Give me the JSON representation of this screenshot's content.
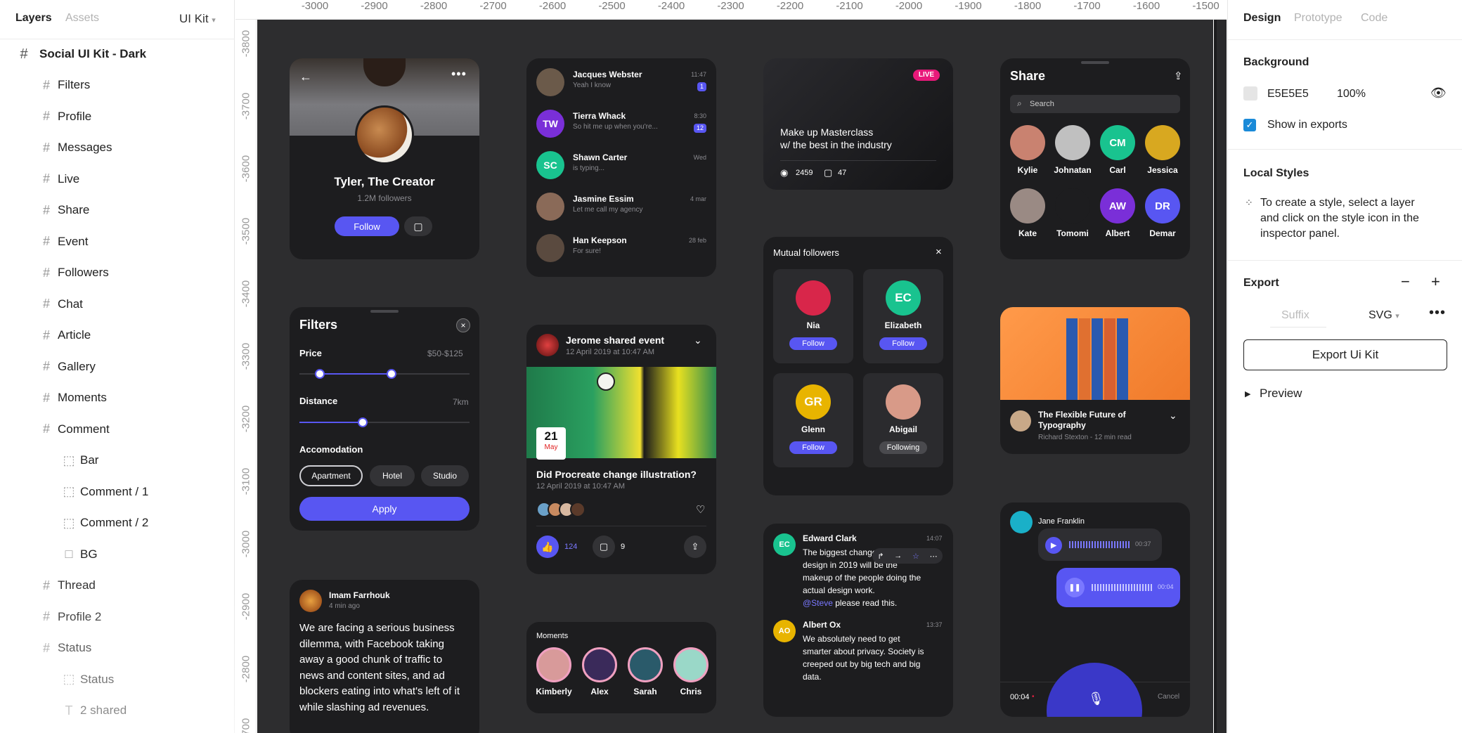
{
  "left_panel": {
    "tabs": [
      "Layers",
      "Assets"
    ],
    "page_selector": "UI Kit",
    "root": "Social UI Kit - Dark",
    "layers": [
      {
        "name": "Filters",
        "type": "frame"
      },
      {
        "name": "Profile",
        "type": "frame"
      },
      {
        "name": "Messages",
        "type": "frame"
      },
      {
        "name": "Live",
        "type": "frame"
      },
      {
        "name": "Share",
        "type": "frame"
      },
      {
        "name": "Event",
        "type": "frame"
      },
      {
        "name": "Followers",
        "type": "frame"
      },
      {
        "name": "Chat",
        "type": "frame"
      },
      {
        "name": "Article",
        "type": "frame"
      },
      {
        "name": "Gallery",
        "type": "frame"
      },
      {
        "name": "Moments",
        "type": "frame"
      },
      {
        "name": "Comment",
        "type": "frame"
      },
      {
        "name": "Bar",
        "type": "component"
      },
      {
        "name": "Comment / 1",
        "type": "component"
      },
      {
        "name": "Comment / 2",
        "type": "component"
      },
      {
        "name": "BG",
        "type": "rect"
      },
      {
        "name": "Thread",
        "type": "frame"
      },
      {
        "name": "Profile 2",
        "type": "frame"
      },
      {
        "name": "Status",
        "type": "frame"
      },
      {
        "name": "Status",
        "type": "component"
      },
      {
        "name": "2 shared",
        "type": "text"
      }
    ]
  },
  "ruler": {
    "top": [
      "-3000",
      "-2900",
      "-2800",
      "-2700",
      "-2600",
      "-2500",
      "-2400",
      "-2300",
      "-2200",
      "-2100",
      "-2000",
      "-1900",
      "-1800",
      "-1700",
      "-1600",
      "-1500"
    ],
    "left": [
      "-3800",
      "-3700",
      "-3600",
      "-3500",
      "-3400",
      "-3300",
      "-3200",
      "-3100",
      "-3000",
      "-2900",
      "-2800",
      "-2700"
    ]
  },
  "profile": {
    "name": "Tyler, The Creator",
    "followers": "1.2M followers",
    "follow": "Follow"
  },
  "messages": [
    {
      "name": "Jacques Webster",
      "text": "Yeah I know",
      "time": "11:47",
      "badge": "1",
      "initials": "",
      "color": "#6b5a4a"
    },
    {
      "name": "Tierra Whack",
      "text": "So hit me up when you're...",
      "time": "8:30",
      "badge": "12",
      "initials": "TW",
      "color": "#7a2fd8"
    },
    {
      "name": "Shawn Carter",
      "text": "is typing...",
      "time": "Wed",
      "badge": "",
      "initials": "SC",
      "color": "#19c38f"
    },
    {
      "name": "Jasmine Essim",
      "text": "Let me call my agency",
      "time": "4 mar",
      "badge": "",
      "initials": "",
      "color": "#8a6a58"
    },
    {
      "name": "Han Keepson",
      "text": "For sure!",
      "time": "28 feb",
      "badge": "",
      "initials": "",
      "color": "#5a4a3f"
    }
  ],
  "live": {
    "badge": "LIVE",
    "title1": "Make up Masterclass",
    "title2": "w/ the best in the industry",
    "views": "2459",
    "comments": "47"
  },
  "share": {
    "title": "Share",
    "search": "Search",
    "people": [
      {
        "name": "Kylie",
        "initials": "",
        "color": "#c98270"
      },
      {
        "name": "Johnatan",
        "initials": "",
        "color": "#c0c0c0"
      },
      {
        "name": "Carl",
        "initials": "CM",
        "color": "#19c38f"
      },
      {
        "name": "Jessica",
        "initials": "",
        "color": "#d8a820"
      },
      {
        "name": "Kate",
        "initials": "",
        "color": "#9a8a84"
      },
      {
        "name": "Tomomi",
        "initials": "",
        "color": "#1d1d1f"
      },
      {
        "name": "Albert",
        "initials": "AW",
        "color": "#7a2fd8"
      },
      {
        "name": "Demar",
        "initials": "DR",
        "color": "#5856f2"
      }
    ]
  },
  "filters": {
    "title": "Filters",
    "price_label": "Price",
    "price_value": "$50-$125",
    "price_range": [
      0.12,
      0.54
    ],
    "distance_label": "Distance",
    "distance_value": "7km",
    "distance_level": 0.37,
    "accomodation_label": "Accomodation",
    "options": [
      "Apartment",
      "Hotel",
      "Studio"
    ],
    "apply": "Apply"
  },
  "event": {
    "title": "Jerome shared event",
    "date": "12 April 2019 at 10:47 AM",
    "day": "21",
    "month": "May",
    "post_title": "Did Procreate change illustration?",
    "post_date": "12 April 2019 at 10:47 AM",
    "likes": "124",
    "comments": "9"
  },
  "mutual": {
    "title": "Mutual followers",
    "people": [
      {
        "name": "Nia",
        "initials": "",
        "color": "#d8264a",
        "action": "Follow"
      },
      {
        "name": "Elizabeth",
        "initials": "EC",
        "color": "#19c38f",
        "action": "Follow"
      },
      {
        "name": "Glenn",
        "initials": "GR",
        "color": "#e8b400",
        "action": "Follow"
      },
      {
        "name": "Abigail",
        "initials": "",
        "color": "#d89a88",
        "action": "Following"
      }
    ]
  },
  "article": {
    "title1": "The Flexible Future of",
    "title2": "Typography",
    "meta": "Richard Stexton - 12 min read"
  },
  "comment_card": {
    "author": "Imam Farrhouk",
    "time": "4 min ago",
    "lines": [
      "We are facing a serious business",
      "dilemma, with Facebook taking",
      "away a good chunk of traffic to",
      "news and content sites, and ad",
      "blockers eating into what's left of it",
      "while slashing ad revenues."
    ]
  },
  "moments": {
    "title": "Moments",
    "people": [
      {
        "name": "Kimberly",
        "color": "#d89a9a"
      },
      {
        "name": "Alex",
        "color": "#3a2a5a"
      },
      {
        "name": "Sarah",
        "color": "#2a5a6a"
      },
      {
        "name": "Chris",
        "color": "#9ad8c8"
      }
    ]
  },
  "chat": {
    "msg1": {
      "name": "Edward Clark",
      "initials": "EC",
      "time": "14:07",
      "lines": [
        "The biggest change",
        "design in 2019 will be the",
        "makeup of the people doing the",
        "actual design work."
      ],
      "mention": "@Steve",
      "mention_rest": " please read this."
    },
    "msg2": {
      "name": "Albert Ox",
      "initials": "AO",
      "time": "13:37",
      "lines": [
        "We absolutely need to get",
        "smarter about privacy. Society is",
        "creeped out by big tech and big",
        "data."
      ]
    }
  },
  "voice": {
    "name": "Jane Franklin",
    "d1": "00:37",
    "d2": "00:04",
    "rec": "00:04",
    "cancel": "Cancel"
  },
  "right_panel": {
    "tabs": [
      "Design",
      "Prototype",
      "Code"
    ],
    "background_title": "Background",
    "bg_hex": "E5E5E5",
    "bg_opacity": "100%",
    "bg_color": "#e5e5e5",
    "show_exports": "Show in exports",
    "local_styles_title": "Local Styles",
    "local_styles_lines": [
      "To create a style, select a layer",
      "and click on the style icon in the",
      "inspector panel."
    ],
    "export_title": "Export",
    "suffix_placeholder": "Suffix",
    "format": "SVG",
    "export_button": "Export Ui Kit",
    "preview": "Preview"
  }
}
